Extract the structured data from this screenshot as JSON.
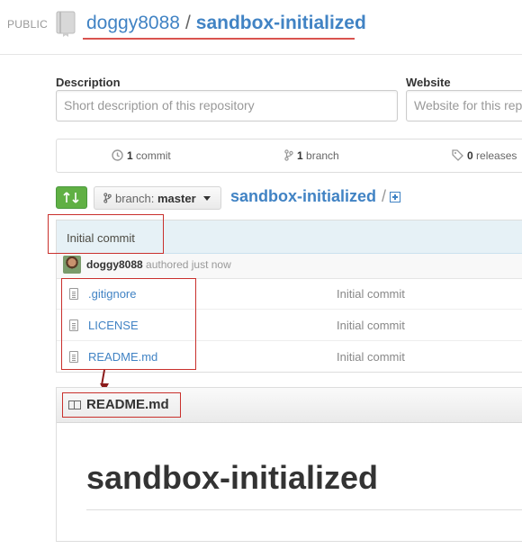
{
  "header": {
    "visibility": "PUBLIC",
    "owner": "doggy8088",
    "separator": "/",
    "repo": "sandbox-initialized"
  },
  "meta": {
    "description_label": "Description",
    "description_placeholder": "Short description of this repository",
    "website_label": "Website",
    "website_placeholder": "Website for this repository"
  },
  "stats": {
    "commits_count": "1",
    "commits_label": "commit",
    "branches_count": "1",
    "branches_label": "branch",
    "releases_count": "0",
    "releases_label": "releases"
  },
  "branch": {
    "prefix": "branch:",
    "name": "master",
    "crumb_repo": "sandbox-initialized",
    "crumb_sep": "/"
  },
  "commit": {
    "message": "Initial commit",
    "author": "doggy8088",
    "authored": "authored just now"
  },
  "files": [
    {
      "name": ".gitignore",
      "message": "Initial commit"
    },
    {
      "name": "LICENSE",
      "message": "Initial commit"
    },
    {
      "name": "README.md",
      "message": "Initial commit"
    }
  ],
  "readme": {
    "title": "README.md",
    "heading": "sandbox-initialized"
  },
  "colors": {
    "link": "#4183c4",
    "annotation": "#c9302c",
    "compare_button": "#60b044"
  }
}
